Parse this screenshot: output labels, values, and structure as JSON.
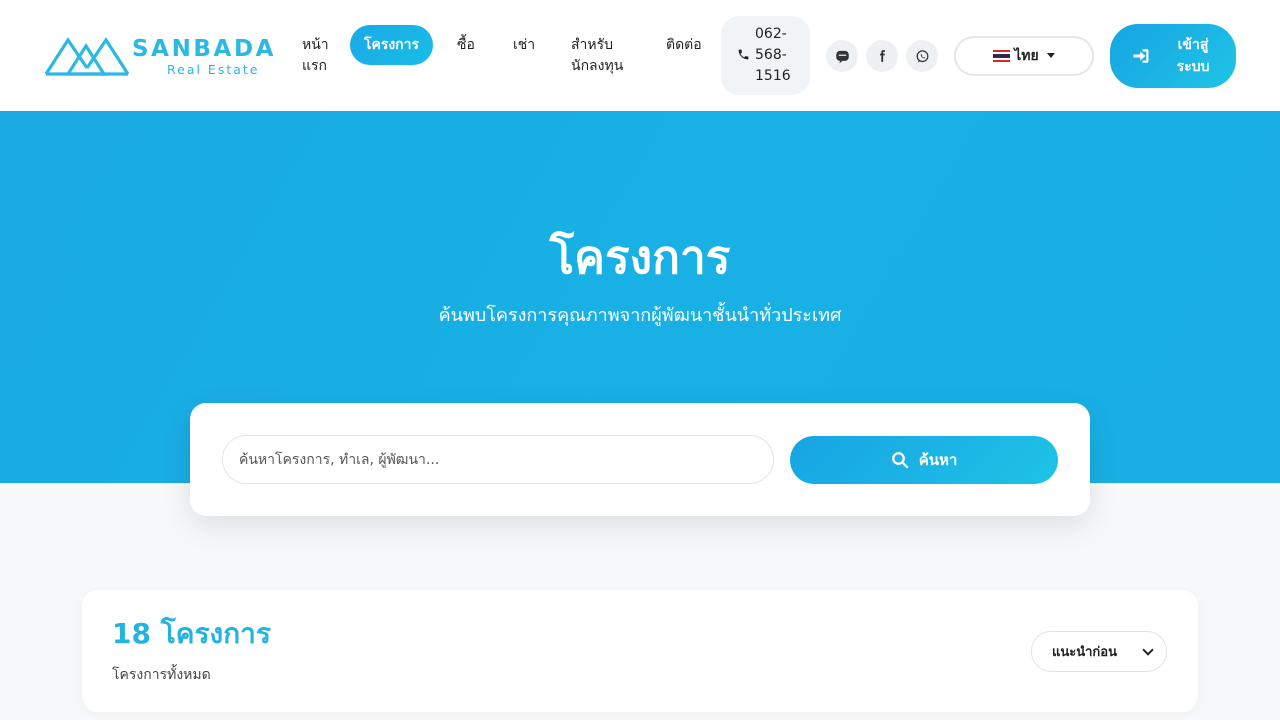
{
  "brand": {
    "name": "SANBADA",
    "tagline": "Real Estate"
  },
  "nav": {
    "home": "หน้าแรก",
    "projects": "โครงการ",
    "buy": "ซื้อ",
    "rent": "เช่า",
    "investors": "สำหรับนักลงทุน",
    "contact": "ติดต่อ"
  },
  "phone": "062-568-1516",
  "social": [
    "line-icon",
    "facebook-icon",
    "whatsapp-icon"
  ],
  "language": {
    "label": "ไทย"
  },
  "login": {
    "label": "เข้าสู่ระบบ"
  },
  "hero": {
    "title": "โครงการ",
    "subtitle": "ค้นพบโครงการคุณภาพจากผู้พัฒนาชั้นนำทั่วประเทศ"
  },
  "search": {
    "placeholder": "ค้นหาโครงการ, ทำเล, ผู้พัฒนา...",
    "button": "ค้นหา"
  },
  "results": {
    "count": "18 โครงการ",
    "label": "โครงการทั้งหมด",
    "sort_selected": "แนะนำก่อน"
  },
  "colors": {
    "accent": "#19aee4",
    "header_bg": "#ffffff",
    "page_bg": "#f6f8fa",
    "count_text": "#22b3de"
  }
}
